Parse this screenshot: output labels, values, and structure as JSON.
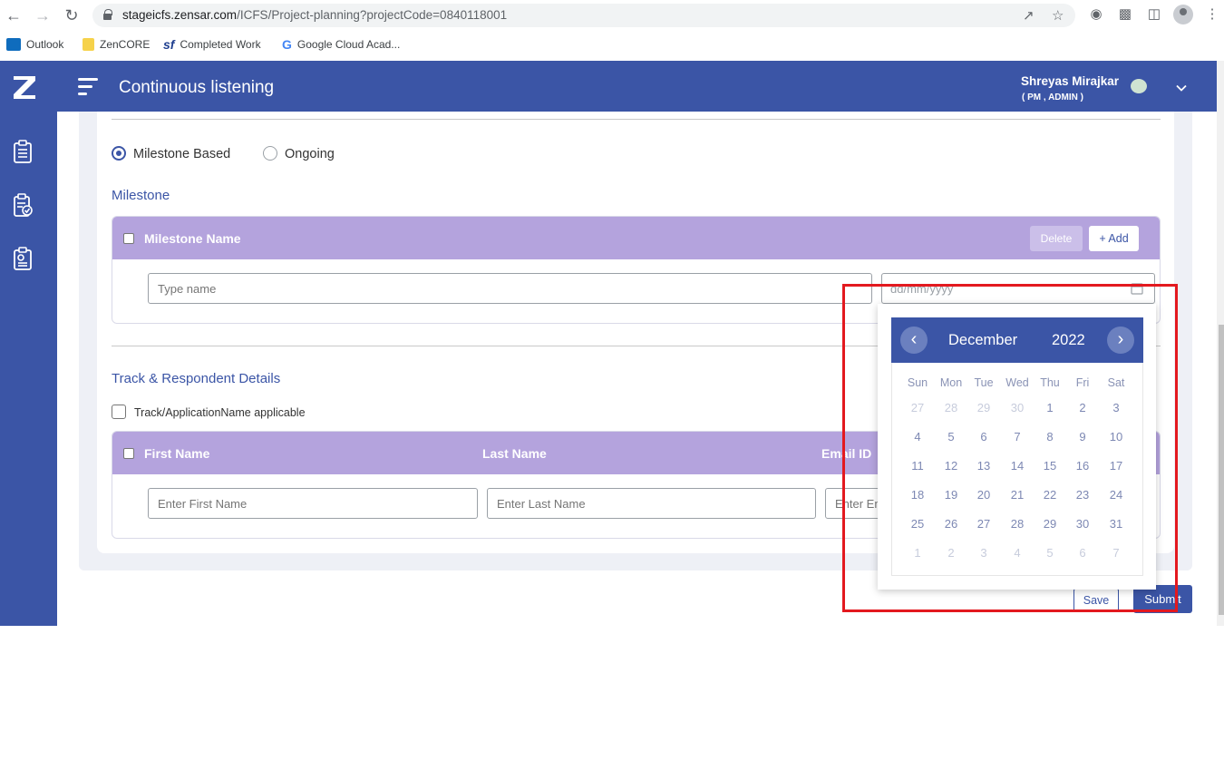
{
  "browser": {
    "url_host": "stageicfs.zensar.com",
    "url_path": "/ICFS/Project-planning?projectCode=0840118001",
    "bookmarks": [
      {
        "label": "Outlook",
        "icon": "outlook-icon",
        "color": "#0f6cbd"
      },
      {
        "label": "ZenCORE",
        "icon": "folder-icon",
        "color": "#f6d24a"
      },
      {
        "label": "Completed Work",
        "icon": "sf-icon",
        "color": "#1f3f8f"
      },
      {
        "label": "Google Cloud Acad...",
        "icon": "google-icon",
        "color": "#4285f4"
      }
    ]
  },
  "header": {
    "title": "Continuous listening",
    "user_name": "Shreyas Mirajkar",
    "user_role": "( PM , ADMIN )"
  },
  "sidebar": {
    "items": [
      {
        "icon": "clipboard-list-icon"
      },
      {
        "icon": "clipboard-check-icon"
      },
      {
        "icon": "clipboard-settings-icon"
      }
    ]
  },
  "form": {
    "radio_milestone": "Milestone Based",
    "radio_ongoing": "Ongoing",
    "milestone_section": "Milestone",
    "milestone_col": "Milestone Name",
    "delete_label": "Delete",
    "add_label": "+ Add",
    "name_placeholder": "Type name",
    "date_placeholder": "dd/mm/yyyy",
    "track_section": "Track & Respondent Details",
    "track_checkbox": "Track/ApplicationName applicable",
    "col_first": "First Name",
    "col_last": "Last Name",
    "col_email": "Email ID",
    "first_placeholder": "Enter First Name",
    "last_placeholder": "Enter Last Name",
    "email_placeholder": "Enter Em",
    "save_label": "Save",
    "submit_label": "Submit"
  },
  "datepicker": {
    "month": "December",
    "year": "2022",
    "prev": "‹",
    "next": "›",
    "weekdays": [
      "Sun",
      "Mon",
      "Tue",
      "Wed",
      "Thu",
      "Fri",
      "Sat"
    ],
    "weeks": [
      [
        "27",
        "28",
        "29",
        "30",
        "1",
        "2",
        "3"
      ],
      [
        "4",
        "5",
        "6",
        "7",
        "8",
        "9",
        "10"
      ],
      [
        "11",
        "12",
        "13",
        "14",
        "15",
        "16",
        "17"
      ],
      [
        "18",
        "19",
        "20",
        "21",
        "22",
        "23",
        "24"
      ],
      [
        "25",
        "26",
        "27",
        "28",
        "29",
        "30",
        "31"
      ],
      [
        "1",
        "2",
        "3",
        "4",
        "5",
        "6",
        "7"
      ]
    ],
    "other_month_mask": [
      [
        true,
        true,
        true,
        true,
        false,
        false,
        false
      ],
      [
        false,
        false,
        false,
        false,
        false,
        false,
        false
      ],
      [
        false,
        false,
        false,
        false,
        false,
        false,
        false
      ],
      [
        false,
        false,
        false,
        false,
        false,
        false,
        false
      ],
      [
        false,
        false,
        false,
        false,
        false,
        false,
        false
      ],
      [
        true,
        true,
        true,
        true,
        true,
        true,
        true
      ]
    ]
  },
  "colors": {
    "brand": "#3b55a6",
    "table_header": "#b4a3dd",
    "highlight": "#e3191f"
  }
}
